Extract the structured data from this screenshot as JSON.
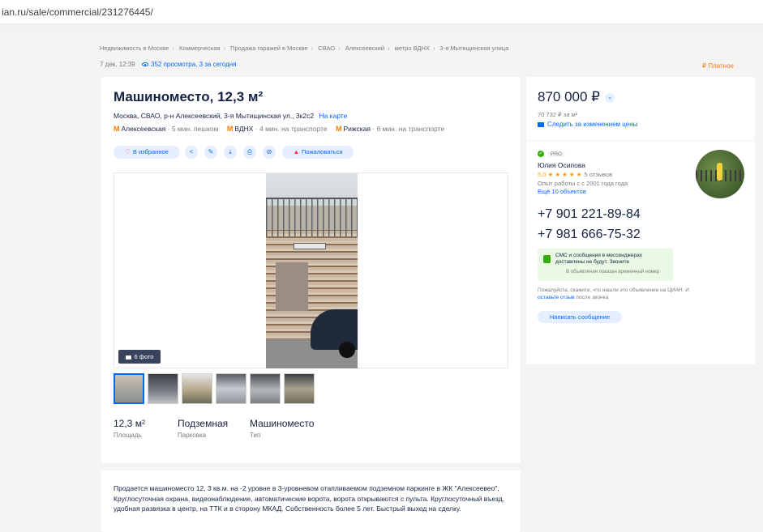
{
  "browser": {
    "url": "ian.ru/sale/commercial/231276445/"
  },
  "breadcrumbs": [
    "Недвижимость в Москве",
    "Коммерческая",
    "Продажа гаражей в Москве",
    "СВАО",
    "Алексеевский",
    "метро ВДНХ",
    "3-я Мытищинская улица"
  ],
  "meta": {
    "date": "7 дек, 12:39",
    "views": "352 просмотра, 3 за сегодня"
  },
  "paid_label": "Платное",
  "paid_icon": "₽",
  "listing": {
    "title": "Машиноместо, 12,3 м²",
    "address": "Москва, СВАО, р-н Алексеевский, 3-я Мытищинская ул., 3к2с2",
    "map_link": "На карте",
    "metro": [
      {
        "name": "Алексеевская",
        "time": "· 5 мин. пешком"
      },
      {
        "name": "ВДНХ",
        "time": "· 4 мин. на транспорте"
      },
      {
        "name": "Рижская",
        "time": "· 6 мин. на транспорте"
      }
    ],
    "actions": {
      "favorite": "В избранное",
      "complain": "Пожаловаться"
    },
    "action_icons": [
      "share-icon",
      "edit-icon",
      "download-icon",
      "print-icon",
      "hide-icon"
    ],
    "photo_count": "6 фото",
    "facts": [
      {
        "value": "12,3 м²",
        "label": "Площадь"
      },
      {
        "value": "Подземная",
        "label": "Парковка"
      },
      {
        "value": "Машиноместо",
        "label": "Тип"
      }
    ],
    "description": "Продается машиноместо 12, 3 кв.м. на -2 уровне в 3-уровневом отапливаемом подземном паркинге в ЖК \"Алексеевео\". Круглосуточная охрана, видеонаблюдение, автоматические ворота, ворота открываются с пульта. Круглосуточный въезд, удобная развязка в центр, на ТТК и в сторону МКАД. Собственность более 5 лет. Быстрый выход на сделку."
  },
  "price": {
    "value": "870 000 ₽",
    "per_meter": "70 732 ₽ за м²",
    "follow": "Следить за изменением цены"
  },
  "agent": {
    "pro": "PRO",
    "name": "Юлия Осипова",
    "rating": "5,0 ★ ★ ★ ★ ★",
    "reviews": "5 отзывов",
    "experience": "Опыт работы с с 2001 года года",
    "more_objects": "Ещё 10 объектов",
    "phones": [
      "+7 901 221-89-84",
      "+7 981 666-75-32"
    ],
    "sms_notice": "СМС и сообщения в мессенджерах доставлены не будут. Звоните",
    "sms_sub": "В объявлении показан временный номер",
    "note_before": "Пожалуйста, скажите, что нашли это объявление на ЦИАН. И ",
    "note_link": "оставьте отзыв",
    "note_after": " после звонка",
    "write_button": "Написать сообщение"
  },
  "colors": {
    "accent": "#0468ff",
    "metro": "#ff7d00",
    "paid": "#ff7d00",
    "pro_check": "#34ac0a",
    "text": "#152242"
  }
}
